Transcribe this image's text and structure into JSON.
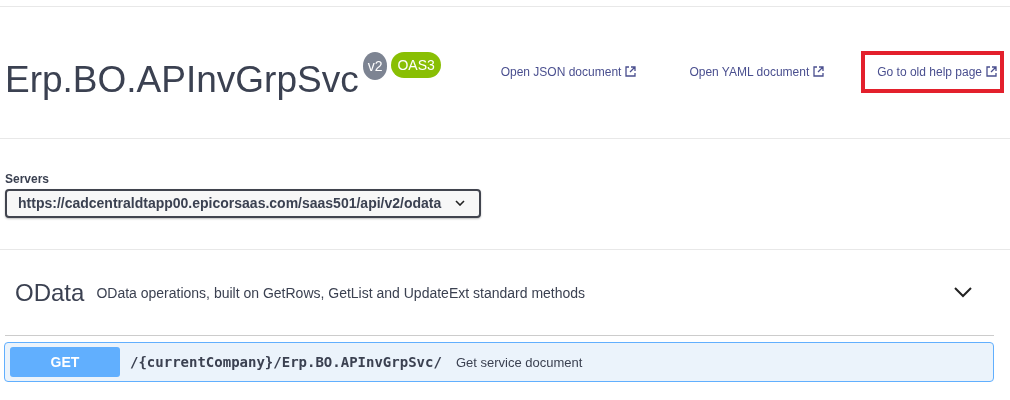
{
  "info": {
    "title": "Erp.BO.APInvGrpSvc",
    "version": "v2",
    "oas": "OAS3"
  },
  "links": [
    {
      "label": "Open JSON document",
      "highlighted": false
    },
    {
      "label": "Open YAML document",
      "highlighted": false
    },
    {
      "label": "Go to old help page",
      "highlighted": true
    }
  ],
  "servers": {
    "label": "Servers",
    "value": "https://cadcentraldtapp00.epicorsaas.com/saas501/api/v2/odata"
  },
  "tag": {
    "name": "OData",
    "description": "OData operations, built on GetRows, GetList and UpdateExt standard methods",
    "expanded": true,
    "operations": [
      {
        "method": "GET",
        "path": "/{currentCompany}/Erp.BO.APInvGrpSvc/",
        "summary": "Get service document"
      }
    ]
  }
}
